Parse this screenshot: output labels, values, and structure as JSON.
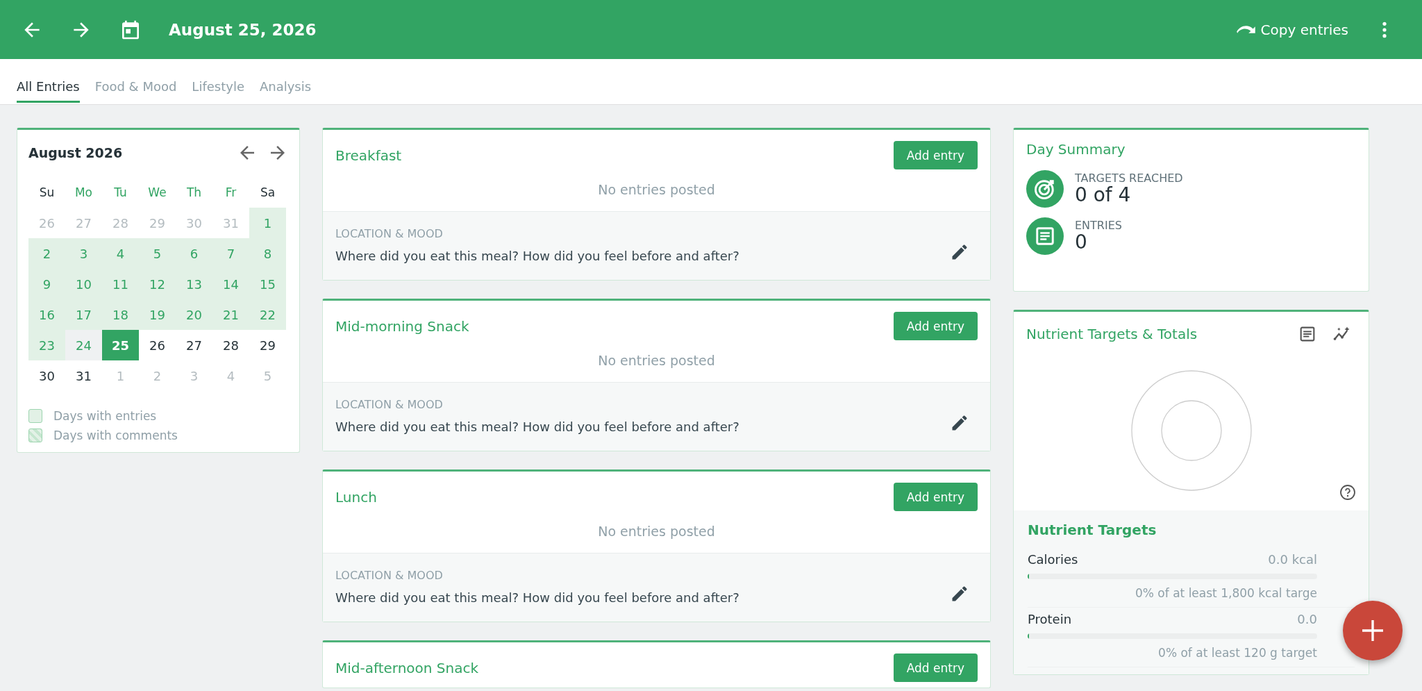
{
  "header": {
    "date": "August 25, 2026",
    "copy_label": "Copy entries"
  },
  "tabs": [
    {
      "label": "All Entries",
      "selected": true
    },
    {
      "label": "Food & Mood",
      "selected": false
    },
    {
      "label": "Lifestyle",
      "selected": false
    },
    {
      "label": "Analysis",
      "selected": false
    }
  ],
  "calendar": {
    "title": "August 2026",
    "weekdays": [
      {
        "label": "Su",
        "weekend": true
      },
      {
        "label": "Mo",
        "weekend": false
      },
      {
        "label": "Tu",
        "weekend": false
      },
      {
        "label": "We",
        "weekend": false
      },
      {
        "label": "Th",
        "weekend": false
      },
      {
        "label": "Fr",
        "weekend": false
      },
      {
        "label": "Sa",
        "weekend": true
      }
    ],
    "days": [
      {
        "label": "26",
        "kind": "outside",
        "selected": false
      },
      {
        "label": "27",
        "kind": "outside",
        "selected": false
      },
      {
        "label": "28",
        "kind": "outside",
        "selected": false
      },
      {
        "label": "29",
        "kind": "outside",
        "selected": false
      },
      {
        "label": "30",
        "kind": "outside",
        "selected": false
      },
      {
        "label": "31",
        "kind": "outside",
        "selected": false
      },
      {
        "label": "1",
        "kind": "entries",
        "selected": false
      },
      {
        "label": "2",
        "kind": "entries",
        "selected": false
      },
      {
        "label": "3",
        "kind": "entries",
        "selected": false
      },
      {
        "label": "4",
        "kind": "entries",
        "selected": false
      },
      {
        "label": "5",
        "kind": "entries",
        "selected": false
      },
      {
        "label": "6",
        "kind": "entries",
        "selected": false
      },
      {
        "label": "7",
        "kind": "entries",
        "selected": false
      },
      {
        "label": "8",
        "kind": "entries",
        "selected": false
      },
      {
        "label": "9",
        "kind": "entries",
        "selected": false
      },
      {
        "label": "10",
        "kind": "entries",
        "selected": false
      },
      {
        "label": "11",
        "kind": "entries",
        "selected": false
      },
      {
        "label": "12",
        "kind": "entries",
        "selected": false
      },
      {
        "label": "13",
        "kind": "entries",
        "selected": false
      },
      {
        "label": "14",
        "kind": "entries",
        "selected": false
      },
      {
        "label": "15",
        "kind": "entries",
        "selected": false
      },
      {
        "label": "16",
        "kind": "entries",
        "selected": false
      },
      {
        "label": "17",
        "kind": "entries",
        "selected": false
      },
      {
        "label": "18",
        "kind": "entries",
        "selected": false
      },
      {
        "label": "19",
        "kind": "entries",
        "selected": false
      },
      {
        "label": "20",
        "kind": "entries",
        "selected": false
      },
      {
        "label": "21",
        "kind": "entries",
        "selected": false
      },
      {
        "label": "22",
        "kind": "entries",
        "selected": false
      },
      {
        "label": "23",
        "kind": "entries",
        "selected": false
      },
      {
        "label": "24",
        "kind": "today",
        "selected": false
      },
      {
        "label": "25",
        "kind": "plain",
        "selected": true
      },
      {
        "label": "26",
        "kind": "plain",
        "selected": false
      },
      {
        "label": "27",
        "kind": "plain",
        "selected": false
      },
      {
        "label": "28",
        "kind": "plain",
        "selected": false
      },
      {
        "label": "29",
        "kind": "plain",
        "selected": false
      },
      {
        "label": "30",
        "kind": "plain",
        "selected": false
      },
      {
        "label": "31",
        "kind": "plain",
        "selected": false
      },
      {
        "label": "1",
        "kind": "outside",
        "selected": false
      },
      {
        "label": "2",
        "kind": "outside",
        "selected": false
      },
      {
        "label": "3",
        "kind": "outside",
        "selected": false
      },
      {
        "label": "4",
        "kind": "outside",
        "selected": false
      },
      {
        "label": "5",
        "kind": "outside",
        "selected": false
      }
    ],
    "legend": [
      {
        "label": "Days with entries",
        "kind": "entries"
      },
      {
        "label": "Days with comments",
        "kind": "comments"
      }
    ]
  },
  "meals": [
    {
      "title": "Breakfast",
      "button": "Add entry",
      "empty": "No entries posted",
      "section_label": "LOCATION & MOOD",
      "prompt": "Where did you eat this meal? How did you feel before and after?"
    },
    {
      "title": "Mid-morning Snack",
      "button": "Add entry",
      "empty": "No entries posted",
      "section_label": "LOCATION & MOOD",
      "prompt": "Where did you eat this meal? How did you feel before and after?"
    },
    {
      "title": "Lunch",
      "button": "Add entry",
      "empty": "No entries posted",
      "section_label": "LOCATION & MOOD",
      "prompt": "Where did you eat this meal? How did you feel before and after?"
    },
    {
      "title": "Mid-afternoon Snack",
      "button": "Add entry"
    }
  ],
  "day_summary": {
    "title": "Day Summary",
    "stats": [
      {
        "label": "TARGETS REACHED",
        "value": "0 of 4",
        "kind": "target"
      },
      {
        "label": "ENTRIES",
        "value": "0",
        "kind": "entries"
      }
    ]
  },
  "nutrients": {
    "title": "Nutrient Targets & Totals",
    "section_title": "Nutrient Targets",
    "rows": [
      {
        "name": "Calories",
        "amount": "0.0 kcal",
        "level": 0,
        "note": "0% of at least 1,800 kcal targe"
      },
      {
        "name": "Protein",
        "amount": "0.0",
        "level": 0,
        "note": "0% of at least 120 g target"
      }
    ]
  }
}
